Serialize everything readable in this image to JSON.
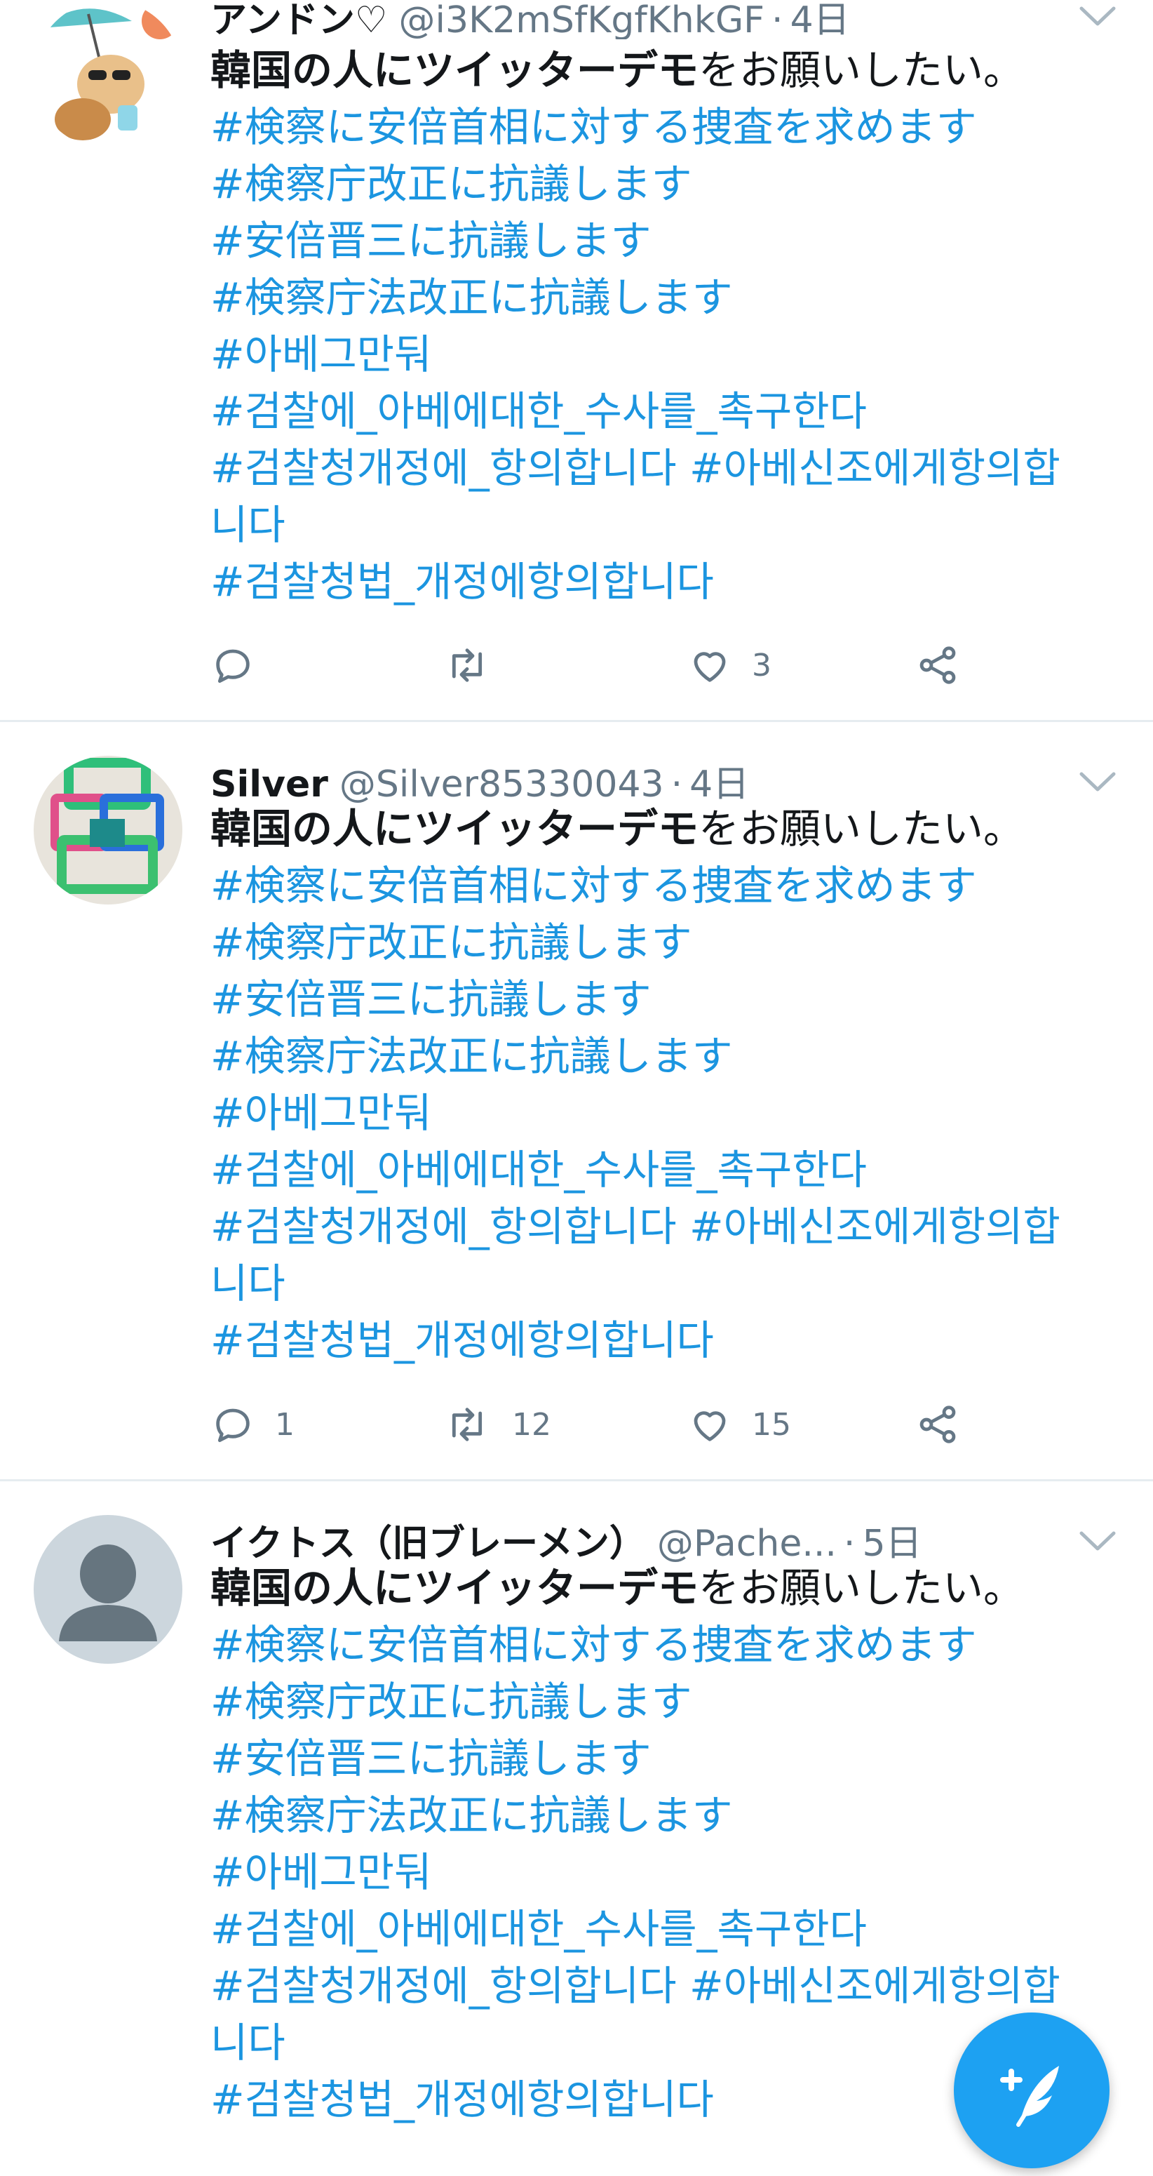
{
  "colors": {
    "accent": "#1da1f2",
    "hashtag": "#1b95e0",
    "muted": "#657786",
    "divider": "#e6ecf0"
  },
  "tweets": [
    {
      "name": "アンドン♡",
      "handle": "@i3K2mSfKgfKhkGF",
      "sep": "·",
      "time": "4日",
      "lead_bold": "韓国の人にツイッターデモ",
      "lead_rest": "をお願いしたい。",
      "tags": [
        "#検察に安倍首相に対する捜査を求めます",
        "#検察庁改正に抗議します",
        "#安倍晋三に抗議します",
        "#検察庁法改正に抗議します",
        "#아베그만둬",
        "#검찰에_아베에대한_수사를_촉구한다",
        "#검찰청개정에_항의합니다 #아베신조에게항의합",
        "니다",
        "#검찰청법_개정에항의합니다"
      ],
      "reply_count": "",
      "retweet_count": "",
      "like_count": "3"
    },
    {
      "name": "Silver",
      "handle": "@Silver85330043",
      "sep": "·",
      "time": "4日",
      "lead_bold": "韓国の人にツイッターデモ",
      "lead_rest": "をお願いしたい。",
      "tags": [
        "#検察に安倍首相に対する捜査を求めます",
        "#検察庁改正に抗議します",
        "#安倍晋三に抗議します",
        "#検察庁法改正に抗議します",
        "#아베그만둬",
        "#검찰에_아베에대한_수사를_촉구한다",
        "#검찰청개정에_항의합니다 #아베신조에게항의합",
        "니다",
        "#검찰청법_개정에항의합니다"
      ],
      "reply_count": "1",
      "retweet_count": "12",
      "like_count": "15"
    },
    {
      "name": "イクトス（旧ブレーメン）",
      "handle": "@Pache...",
      "sep": "·",
      "time": "5日",
      "lead_bold": "韓国の人にツイッターデモ",
      "lead_rest": "をお願いしたい。",
      "tags": [
        "#検察に安倍首相に対する捜査を求めます",
        "#検察庁改正に抗議します",
        "#安倍晋三に抗議します",
        "#検察庁法改正に抗議します",
        "#아베그만둬",
        "#검찰에_아베에대한_수사를_촉구한다",
        "#검찰청개정에_항의합니다 #아베신조에게항의합",
        "니다",
        "#검찰청법_개정에항의합니다"
      ]
    }
  ]
}
